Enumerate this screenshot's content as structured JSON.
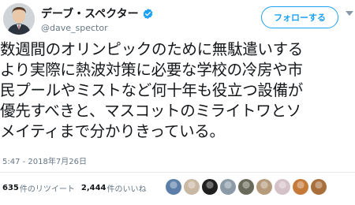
{
  "user": {
    "display_name": "デーブ・スペクター",
    "handle": "@dave_spector",
    "verified_icon": "verified-badge-icon",
    "avatar_icon": "profile-avatar"
  },
  "follow_button": {
    "label": "フォローする"
  },
  "menu_icon": "chevron-down-icon",
  "tweet": {
    "lines": [
      "数週間のオリンピックのために無駄遣いする",
      "より実際に熱波対策に必要な学校の冷房や市",
      "民プールやミストなど何十年も役立つ設備が",
      "優先すべきと、マスコットのミライトワとソ",
      "メイティまで分かりきっている。"
    ],
    "timestamp": "5:47 - 2018年7月26日"
  },
  "stats": {
    "retweets_count": "635",
    "retweets_label": "件のリツイート",
    "likes_count": "2,444",
    "likes_label": "件のいいね"
  },
  "likers": [
    {
      "name": "liker-avatar",
      "color": "#5b7fa8"
    },
    {
      "name": "liker-avatar",
      "color": "#c9b8a4"
    },
    {
      "name": "liker-avatar",
      "color": "#1f1f1f"
    },
    {
      "name": "liker-avatar",
      "color": "#8a9aa6"
    },
    {
      "name": "liker-avatar",
      "color": "#6a6a5a"
    },
    {
      "name": "liker-avatar",
      "color": "#b59a7c"
    },
    {
      "name": "liker-avatar",
      "color": "#d4c2c8"
    },
    {
      "name": "liker-avatar",
      "color": "#c57a3a"
    },
    {
      "name": "liker-avatar",
      "color": "#a86f3c"
    }
  ],
  "colors": {
    "accent": "#1da1f2",
    "text": "#14171a",
    "secondary": "#657786"
  }
}
